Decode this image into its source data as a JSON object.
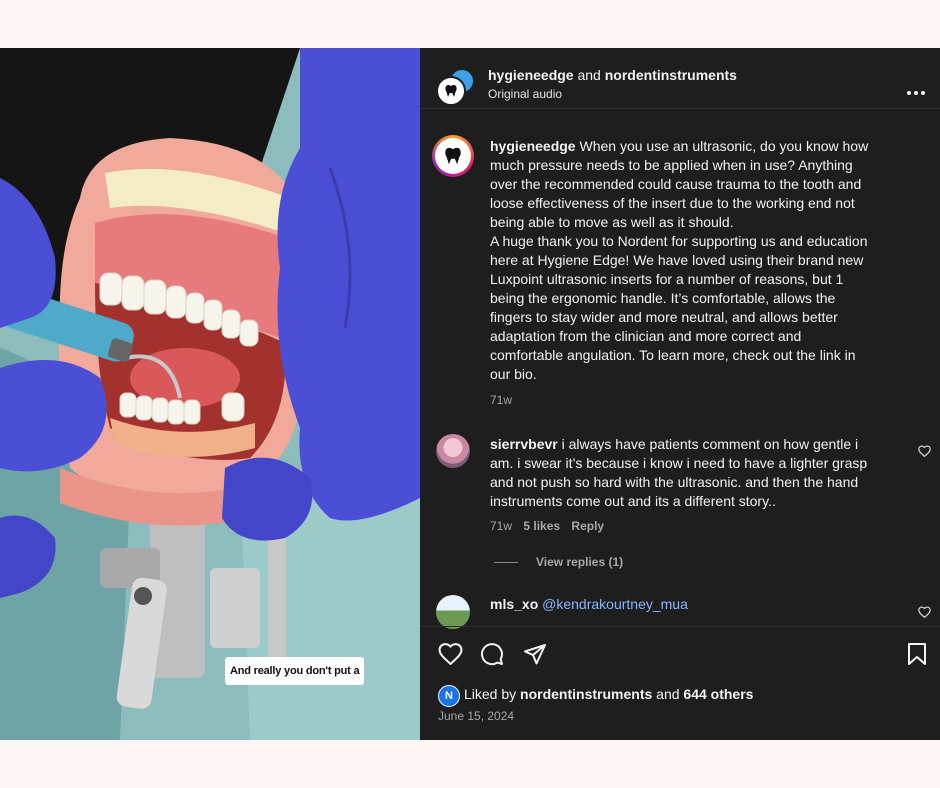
{
  "video": {
    "caption": "And really you don't put a"
  },
  "header": {
    "account": "hygieneedge",
    "connector": "and",
    "collaborator": "nordentinstruments",
    "audio": "Original audio",
    "more_icon": "more-horizontal-icon"
  },
  "post": {
    "username": "hygieneedge",
    "lines": [
      "When you use an ultrasonic, do you know how",
      "much pressure needs to be applied when in use? Anything",
      "over the recommended could cause trauma to the tooth and",
      "loose effectiveness of the insert due to the working end not",
      "being able to move as well as it should.",
      "A huge thank you to Nordent for supporting us and education",
      "here at Hygiene Edge! We have loved using their brand new",
      "Luxpoint ultrasonic inserts for a number of reasons, but 1",
      "being the ergonomic handle. It’s comfortable, allows the",
      "fingers to stay wider and more neutral, and allows better",
      "adaptation from the clinician and more correct and",
      "comfortable angulation. To learn more, check out the link in",
      "our bio."
    ],
    "time": "71w"
  },
  "comments": [
    {
      "username": "sierrvbevr",
      "lines": [
        "i always have patients comment on how gentle i",
        "am. i swear it’s because i know i need to have a lighter grasp",
        "and not push so hard with the ultrasonic. and then the hand",
        "instruments come out and its a different story.."
      ],
      "time": "71w",
      "likes": "5 likes",
      "reply": "Reply",
      "view_replies": "View replies (1)"
    },
    {
      "username": "mls_xo",
      "mention": "@kendrakourtney_mua"
    }
  ],
  "actions": {
    "like_icon": "heart-icon",
    "comment_icon": "comment-icon",
    "share_icon": "send-icon",
    "save_icon": "bookmark-icon"
  },
  "likes": {
    "prefix": "Liked by",
    "user": "nordentinstruments",
    "connector": "and",
    "others": "644 others"
  },
  "date": "June 15, 2024",
  "colors": {
    "panel_bg": "#1e1e1e",
    "page_bg": "#fcf6f4",
    "link": "#8ab4ff",
    "glove": "#4b4fd6"
  }
}
